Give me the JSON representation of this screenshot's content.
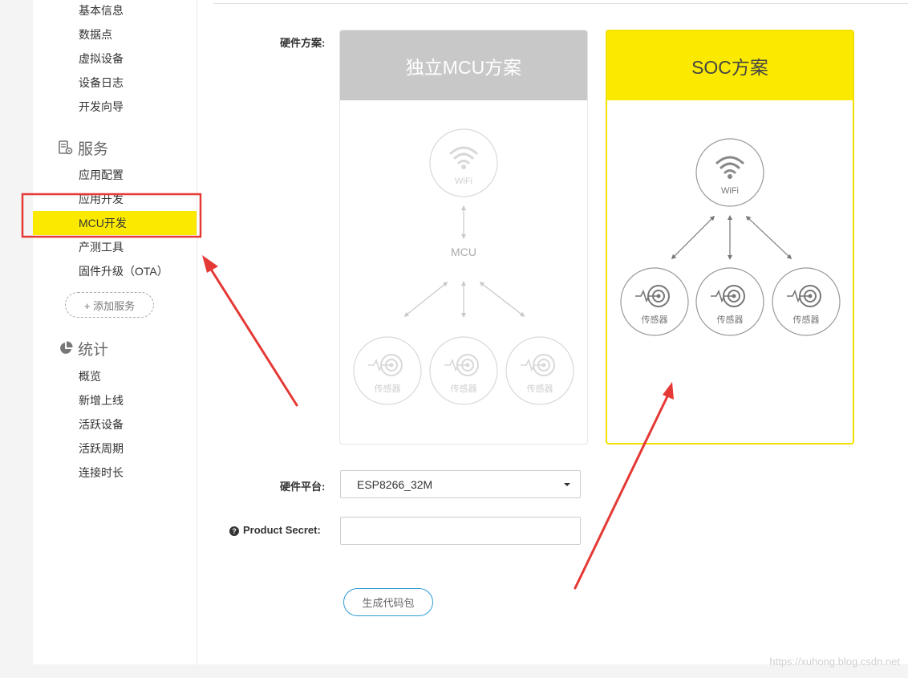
{
  "sidebar": {
    "top_items": [
      "基本信息",
      "数据点",
      "虚拟设备",
      "设备日志",
      "开发向导"
    ],
    "service_section": {
      "title": "服务",
      "icon": "gear-server-icon",
      "items": [
        "应用配置",
        "应用开发",
        "MCU开发",
        "产测工具",
        "固件升级（OTA）"
      ],
      "active_item": "MCU开发",
      "add_label": "+ 添加服务"
    },
    "stats_section": {
      "title": "统计",
      "icon": "pie-chart-icon",
      "items": [
        "概览",
        "新增上线",
        "活跃设备",
        "活跃周期",
        "连接时长"
      ]
    }
  },
  "form": {
    "hardware_scheme_label": "硬件方案:",
    "schemes": {
      "mcu": {
        "title": "独立MCU方案",
        "wifi_label": "WiFi",
        "mcu_label": "MCU",
        "sensor_label": "传感器",
        "selected": false
      },
      "soc": {
        "title": "SOC方案",
        "wifi_label": "WiFi",
        "sensor_label": "传感器",
        "selected": true
      }
    },
    "hardware_platform_label": "硬件平台:",
    "hardware_platform_value": "ESP8266_32M",
    "product_secret_label": "Product Secret:",
    "product_secret_value": "",
    "generate_button": "生成代码包"
  },
  "colors": {
    "highlight_yellow": "#fbea00",
    "annotation_red": "#e53935",
    "button_border_blue": "#2f9bd7"
  },
  "watermark": "https://xuhong.blog.csdn.net"
}
